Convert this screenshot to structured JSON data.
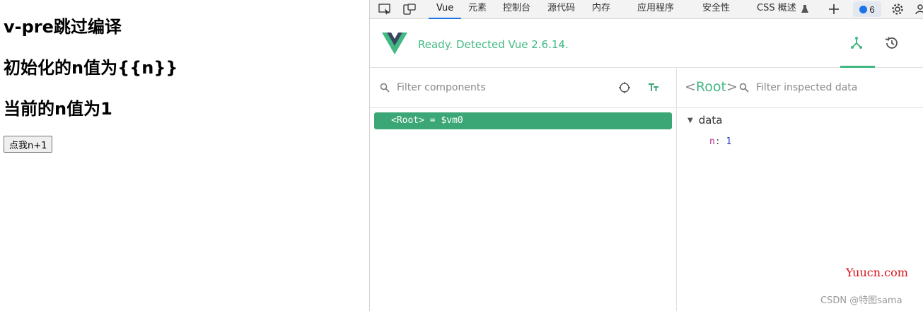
{
  "page": {
    "heading_title": "v-pre跳过编译",
    "heading_init": "初始化的n值为{{n}}",
    "heading_current": "当前的n值为1",
    "button_label": "点我n+1"
  },
  "devtools": {
    "tabs": [
      "Vue",
      "元素",
      "控制台",
      "源代码",
      "内存",
      "应用程序",
      "安全性",
      "CSS 概述"
    ],
    "active_tab": "Vue",
    "badge_count": "6",
    "ready_text": "Ready. Detected Vue 2.6.14.",
    "accent_color": "#42b983",
    "filter_components_placeholder": "Filter components",
    "root_row_label": "<Root> = $vm0",
    "inspector_root_tag": "Root",
    "filter_inspected_placeholder": "Filter inspected data",
    "data_section": "data",
    "data_key": "n",
    "data_value": "1"
  },
  "watermark": {
    "site": "Yuucn.com",
    "author": "CSDN @特图sama"
  }
}
